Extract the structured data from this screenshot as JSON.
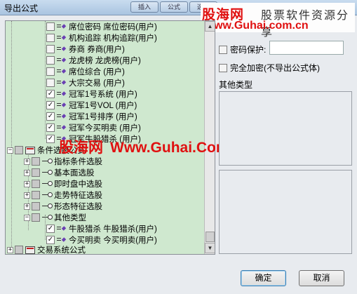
{
  "window": {
    "title": "导出公式",
    "controls": [
      "插入",
      "公式",
      "选股"
    ]
  },
  "watermark": {
    "site_name": "股海网",
    "tagline": "股票软件资源分享",
    "url_top": "Www.Guhai.com.cn",
    "url_mid": "Www.Guhai.Com.CN"
  },
  "tree": {
    "items": [
      {
        "label": "席位密码 席位密码(用户)",
        "checked": false,
        "icon": "formula-icon"
      },
      {
        "label": "机构追踪 机构追踪(用户)",
        "checked": false,
        "icon": "formula-icon"
      },
      {
        "label": "券商 券商(用户)",
        "checked": false,
        "icon": "formula-icon"
      },
      {
        "label": "龙虎榜 龙虎榜(用户)",
        "checked": false,
        "icon": "formula-icon"
      },
      {
        "label": "席位综合 (用户)",
        "checked": false,
        "icon": "formula-icon"
      },
      {
        "label": "大宗交易 (用户)",
        "checked": false,
        "icon": "formula-icon"
      },
      {
        "label": "冠军1号系统 (用户)",
        "checked": true,
        "icon": "formula-icon"
      },
      {
        "label": "冠军1号VOL (用户)",
        "checked": true,
        "icon": "formula-icon"
      },
      {
        "label": "冠军1号排序 (用户)",
        "checked": true,
        "icon": "formula-icon"
      },
      {
        "label": "冠军今买明卖 (用户)",
        "checked": true,
        "icon": "formula-icon"
      },
      {
        "label": "冠军牛股猎杀 (用户)",
        "checked": true,
        "icon": "formula-icon"
      },
      {
        "label": "条件选股公式",
        "checked": false,
        "icon": "folder-icon",
        "expander": "−"
      },
      {
        "label": "指标条件选股",
        "checked": false,
        "icon": "key-icon",
        "expander": "+"
      },
      {
        "label": "基本面选股",
        "checked": false,
        "icon": "key-icon",
        "expander": "+"
      },
      {
        "label": "即时盘中选股",
        "checked": false,
        "icon": "key-icon",
        "expander": "+"
      },
      {
        "label": "走势特征选股",
        "checked": false,
        "icon": "key-icon",
        "expander": "+"
      },
      {
        "label": "形态特征选股",
        "checked": false,
        "icon": "key-icon",
        "expander": "+"
      },
      {
        "label": "其他类型",
        "checked": false,
        "icon": "key-icon",
        "expander": "−"
      },
      {
        "label": "牛股猎杀 牛股猎杀(用户)",
        "checked": true,
        "icon": "formula-icon"
      },
      {
        "label": "今买明卖 今买明卖(用户)",
        "checked": true,
        "icon": "formula-icon"
      },
      {
        "label": "交易系统公式",
        "checked": false,
        "icon": "folder-icon",
        "expander": "+"
      }
    ]
  },
  "options": {
    "password_label": "密码保护:",
    "password_value": "",
    "full_encrypt_label": "完全加密(不导出公式体)",
    "other_type_label": "其他类型"
  },
  "buttons": {
    "ok": "确定",
    "cancel": "取消"
  }
}
